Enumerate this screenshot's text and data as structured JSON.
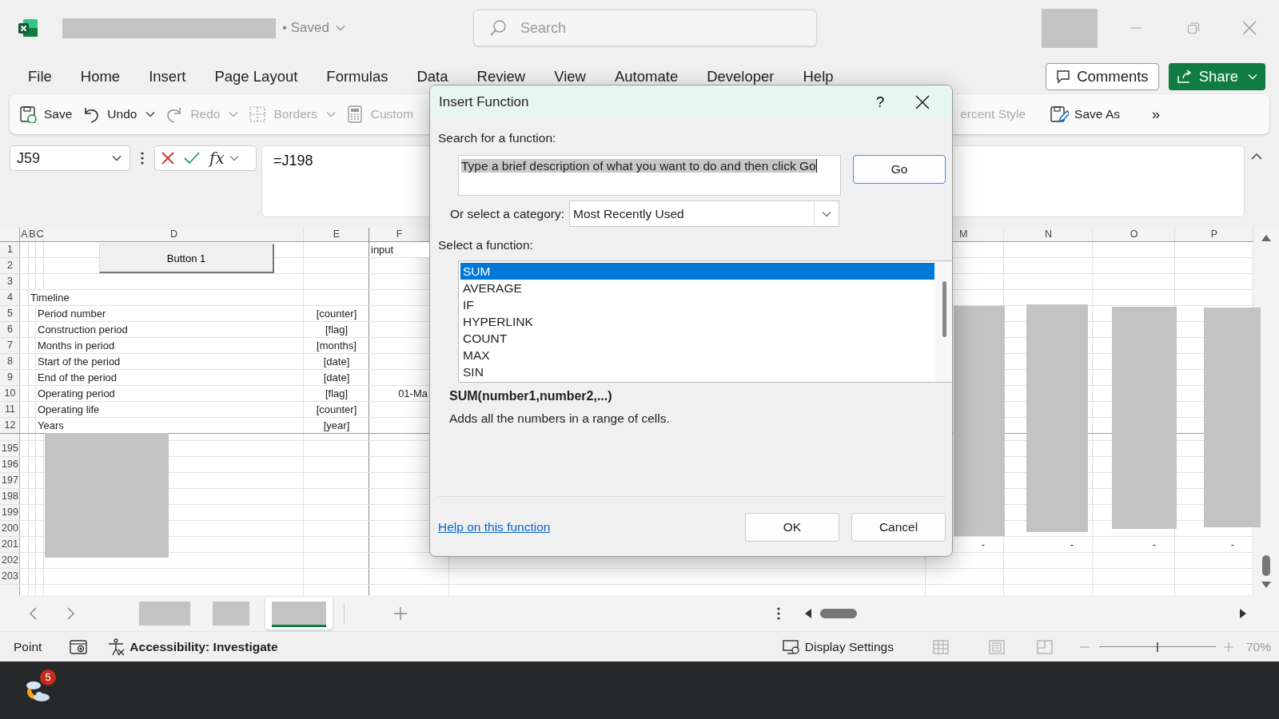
{
  "title_bar": {
    "save_status": "• Saved",
    "search": {
      "placeholder": "Search"
    }
  },
  "menu": [
    "File",
    "Home",
    "Insert",
    "Page Layout",
    "Formulas",
    "Data",
    "Review",
    "View",
    "Automate",
    "Developer",
    "Help"
  ],
  "comments_button": {
    "label": "Comments"
  },
  "share_button": {
    "label": "Share"
  },
  "toolbar": {
    "left": [
      {
        "kind": "save",
        "label": "Save",
        "disabled": false,
        "dropdown": false
      },
      {
        "kind": "undo",
        "label": "Undo",
        "disabled": false,
        "dropdown": true
      },
      {
        "kind": "redo",
        "label": "Redo",
        "disabled": true,
        "dropdown": true
      },
      {
        "kind": "borders",
        "label": "Borders",
        "disabled": true,
        "dropdown": true
      },
      {
        "kind": "calculator",
        "label": "Custom",
        "disabled": true,
        "dropdown": false
      }
    ],
    "right": [
      {
        "kind": "none",
        "label": "ercent Style",
        "disabled": true,
        "dropdown": false
      },
      {
        "kind": "save-as",
        "label": "Save As",
        "disabled": false,
        "dropdown": false
      }
    ],
    "overflow": "»"
  },
  "formula_bar": {
    "name_box": "J59",
    "function_symbol": "fx",
    "formula": "=J198"
  },
  "sheet": {
    "columns": [
      "A",
      "B",
      "C",
      "D",
      "E",
      "F",
      "M",
      "N",
      "O",
      "P"
    ],
    "sheet_button": {
      "label": "Button 1"
    },
    "frozen_rows": [
      {
        "number": "1",
        "cells": {
          "col_f": {
            "kind": "text",
            "text": "input"
          }
        }
      },
      {
        "number": "2",
        "cells": {}
      },
      {
        "number": "3",
        "cells": {}
      },
      {
        "number": "4",
        "cells": {
          "col_b": {
            "kind": "text",
            "text": "Timeline"
          }
        }
      },
      {
        "number": "5",
        "cells": {
          "col_c": {
            "kind": "text",
            "text": "Period number"
          },
          "col_e": {
            "kind": "unit",
            "text": "[counter]"
          }
        }
      },
      {
        "number": "6",
        "cells": {
          "col_c": {
            "kind": "text",
            "text": "Construction period"
          },
          "col_e": {
            "kind": "unit",
            "text": "[flag]"
          }
        }
      },
      {
        "number": "7",
        "cells": {
          "col_c": {
            "kind": "text",
            "text": "Months in period"
          },
          "col_e": {
            "kind": "unit",
            "text": "[months]"
          }
        }
      },
      {
        "number": "8",
        "cells": {
          "col_c": {
            "kind": "text",
            "text": "Start of the period"
          },
          "col_e": {
            "kind": "unit",
            "text": "[date]"
          }
        }
      },
      {
        "number": "9",
        "cells": {
          "col_c": {
            "kind": "text",
            "text": "End of the period"
          },
          "col_e": {
            "kind": "unit",
            "text": "[date]"
          }
        }
      },
      {
        "number": "10",
        "cells": {
          "col_c": {
            "kind": "text",
            "text": "Operating period"
          },
          "col_e": {
            "kind": "unit",
            "text": "[flag]"
          },
          "col_f": {
            "kind": "number",
            "text": "01-Ma"
          }
        }
      },
      {
        "number": "11",
        "cells": {
          "col_c": {
            "kind": "text",
            "text": "Operating life"
          },
          "col_e": {
            "kind": "unit",
            "text": "[counter]"
          }
        }
      },
      {
        "number": "12",
        "cells": {
          "col_c": {
            "kind": "text",
            "text": "Years"
          },
          "col_e": {
            "kind": "unit",
            "text": "[year]"
          }
        }
      }
    ],
    "scrolled_rows": [
      {
        "number": "195",
        "cells": {}
      },
      {
        "number": "196",
        "cells": {}
      },
      {
        "number": "197",
        "cells": {}
      },
      {
        "number": "198",
        "cells": {}
      },
      {
        "number": "199",
        "cells": {}
      },
      {
        "number": "200",
        "cells": {}
      },
      {
        "number": "201",
        "cells": {
          "col_m": {
            "kind": "number",
            "text": "-"
          },
          "col_n": {
            "kind": "number",
            "text": "-"
          },
          "col_o": {
            "kind": "number",
            "text": "-"
          },
          "col_p": {
            "kind": "number",
            "text": "-"
          }
        }
      },
      {
        "number": "202",
        "cells": {}
      },
      {
        "number": "203",
        "cells": {}
      }
    ]
  },
  "sheet_tabs": [
    {
      "selected": false
    },
    {
      "selected": false
    },
    {
      "selected": true
    }
  ],
  "status_bar": {
    "mode": "Point",
    "accessibility": "Accessibility: Investigate",
    "display_settings": "Display Settings",
    "zoom": {
      "level": 0.5,
      "reading": "70%"
    }
  },
  "taskbar": {
    "weather_badge": "5"
  },
  "dialog": {
    "title": "Insert Function",
    "help": "?",
    "search_label": "Search for a function:",
    "search_value": "Type a brief description of what you want to do and then click Go",
    "go": "Go",
    "category_label": "Or select a category:",
    "category": "Most Recently Used",
    "function_label": "Select a function:",
    "functions": [
      {
        "name": "SUM",
        "selected": true
      },
      {
        "name": "AVERAGE",
        "selected": false
      },
      {
        "name": "IF",
        "selected": false
      },
      {
        "name": "HYPERLINK",
        "selected": false
      },
      {
        "name": "COUNT",
        "selected": false
      },
      {
        "name": "MAX",
        "selected": false
      },
      {
        "name": "SIN",
        "selected": false
      }
    ],
    "syntax": "SUM(number1,number2,...)",
    "description": "Adds all the numbers in a range of cells.",
    "help_link": "Help on this function",
    "buttons": [
      "OK",
      "Cancel"
    ]
  }
}
